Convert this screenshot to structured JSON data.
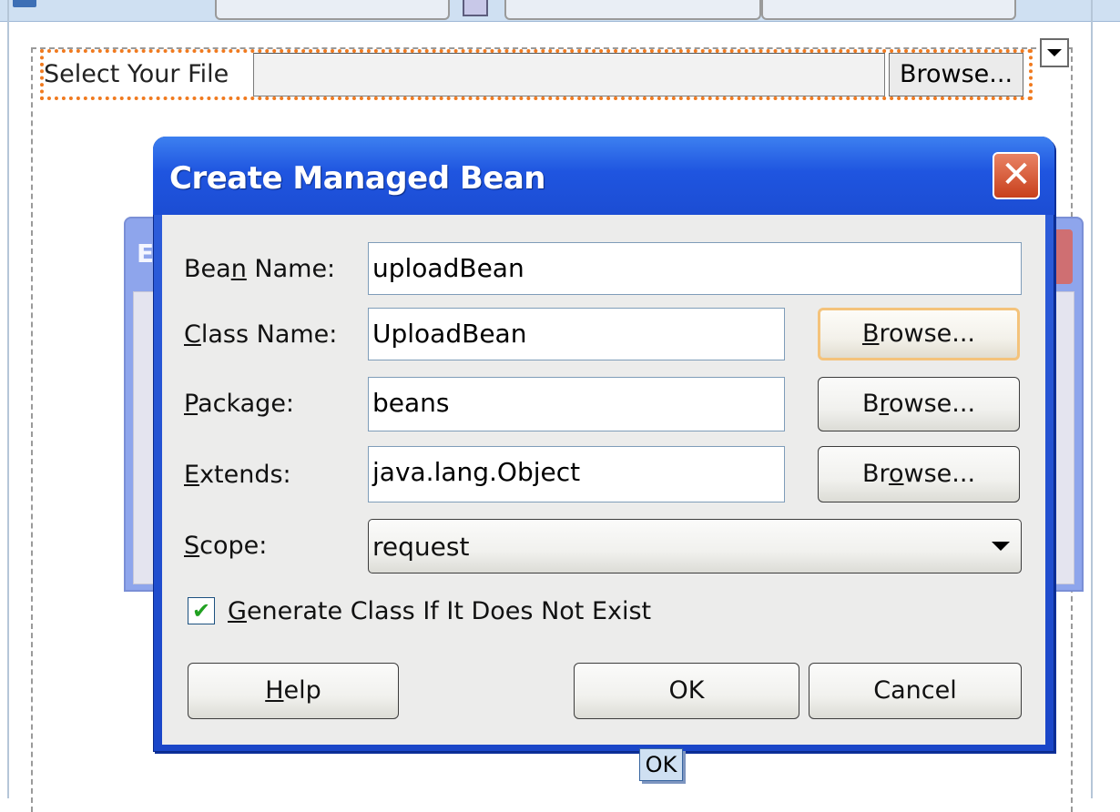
{
  "designer": {
    "file_label": "Select Your File",
    "file_value": "",
    "browse_label": "Browse...",
    "behind_dialog_letter": "E",
    "tooltip_ok": "OK"
  },
  "dialog": {
    "title": "Create Managed Bean",
    "close_symbol": "✕",
    "fields": {
      "bean_name": {
        "label_pre": "Bea",
        "label_key": "n",
        "label_post": " Name:",
        "value": "uploadBean"
      },
      "class_name": {
        "label_pre": "",
        "label_key": "C",
        "label_post": "lass Name:",
        "value": "UploadBean"
      },
      "package": {
        "label_pre": "",
        "label_key": "P",
        "label_post": "ackage:",
        "value": "beans"
      },
      "extends": {
        "label_pre": "",
        "label_key": "E",
        "label_post": "xtends:",
        "value": "java.lang.Object"
      },
      "scope": {
        "label_pre": "",
        "label_key": "S",
        "label_post": "cope:",
        "value": "request"
      }
    },
    "browse_buttons": {
      "class": {
        "pre": "",
        "key": "B",
        "post": "rowse..."
      },
      "package": {
        "pre": "B",
        "key": "r",
        "post": "owse..."
      },
      "extends": {
        "pre": "Br",
        "key": "o",
        "post": "wse..."
      }
    },
    "checkbox": {
      "checked": true,
      "pre": "",
      "key": "G",
      "post": "enerate Class If It Does Not Exist"
    },
    "buttons": {
      "help": {
        "pre": "",
        "key": "H",
        "post": "elp"
      },
      "ok": "OK",
      "cancel": "Cancel"
    }
  },
  "colors": {
    "title_bar": "#1f55e0",
    "focus_outline": "#f07a1f",
    "close_button": "#c8401c",
    "checkmark": "#21a121"
  }
}
